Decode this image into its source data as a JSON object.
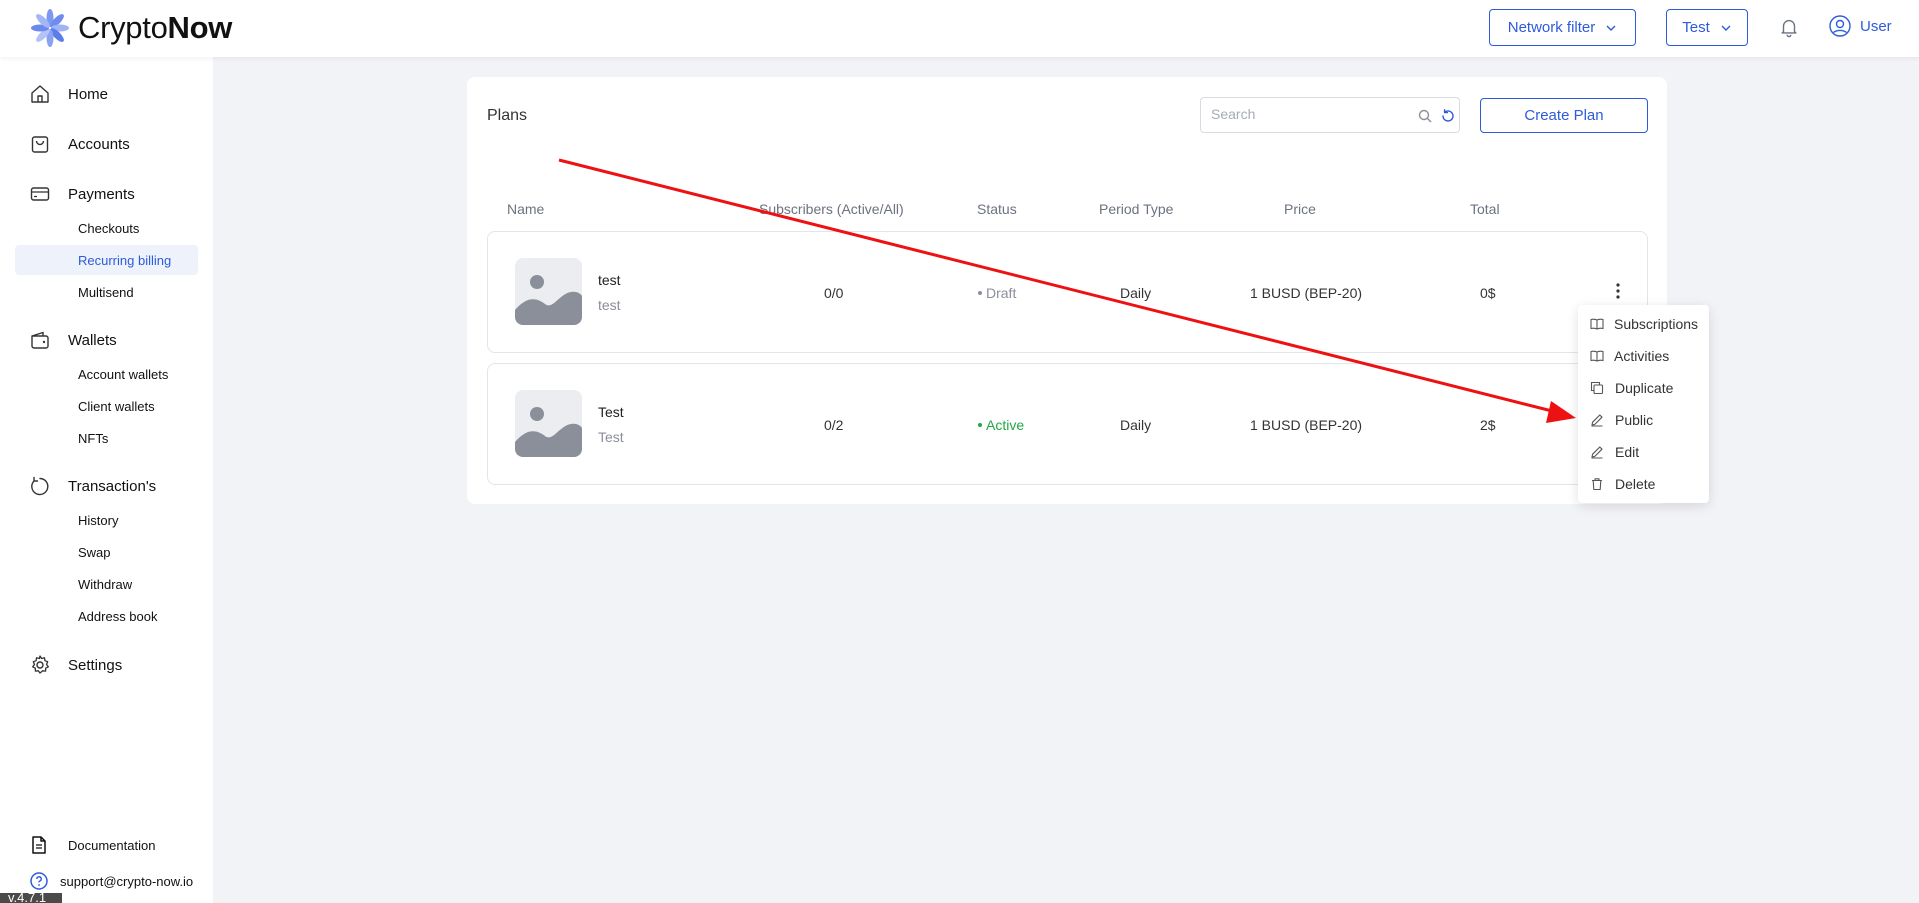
{
  "app": {
    "logo_text_light": "Crypto",
    "logo_text_bold": "Now"
  },
  "header": {
    "network_filter_label": "Network filter",
    "account_selector_label": "Test",
    "user_label": "User"
  },
  "sidebar": {
    "home": "Home",
    "accounts": "Accounts",
    "payments": "Payments",
    "checkouts": "Checkouts",
    "recurring_billing": "Recurring billing",
    "multisend": "Multisend",
    "wallets": "Wallets",
    "account_wallets": "Account wallets",
    "client_wallets": "Client wallets",
    "nfts": "NFTs",
    "transactions": "Transaction's",
    "history": "History",
    "swap": "Swap",
    "withdraw": "Withdraw",
    "address_book": "Address book",
    "settings": "Settings",
    "documentation": "Documentation",
    "support_email": "support@crypto-now.io",
    "version": "v.4.7.1"
  },
  "plans": {
    "title": "Plans",
    "search_placeholder": "Search",
    "create_button": "Create Plan",
    "columns": {
      "name": "Name",
      "subscribers": "Subscribers (Active/All)",
      "status": "Status",
      "period_type": "Period Type",
      "price": "Price",
      "total": "Total"
    },
    "rows": [
      {
        "name": "test",
        "description": "test",
        "subscribers": "0/0",
        "status": "Draft",
        "period": "Daily",
        "price": "1 BUSD (BEP-20)",
        "total": "0$"
      },
      {
        "name": "Test",
        "description": "Test",
        "subscribers": "0/2",
        "status": "Active",
        "period": "Daily",
        "price": "1 BUSD (BEP-20)",
        "total": "2$"
      }
    ]
  },
  "actions_menu": {
    "subscriptions": "Subscriptions",
    "activities": "Activities",
    "duplicate": "Duplicate",
    "public": "Public",
    "edit": "Edit",
    "delete": "Delete"
  },
  "colors": {
    "accent": "#2e5bdb",
    "status_draft": "#8a8f99",
    "status_active": "#22a845",
    "annotation_arrow": "#ee1111"
  }
}
